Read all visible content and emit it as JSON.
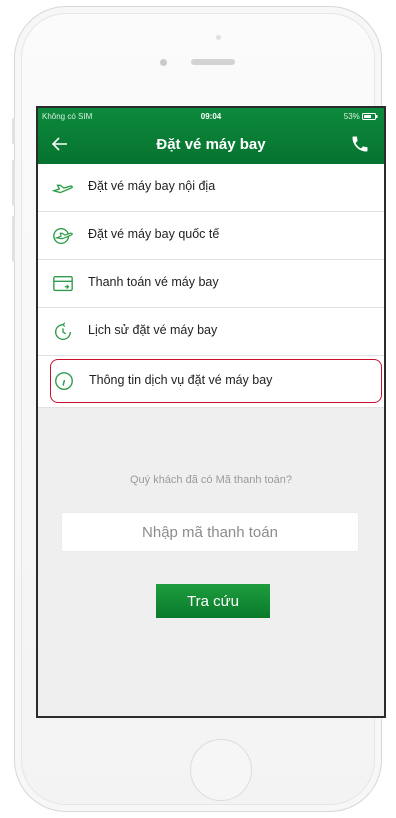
{
  "status_bar": {
    "carrier": "Không có SIM",
    "time": "09:04",
    "battery": "53%"
  },
  "header": {
    "title": "Đặt vé máy bay",
    "back_icon": "arrow-left-icon",
    "call_icon": "phone-icon"
  },
  "menu": {
    "items": [
      {
        "label": "Đặt vé máy bay nội địa",
        "icon": "plane-domestic-icon"
      },
      {
        "label": "Đặt vé máy bay quốc tế",
        "icon": "plane-international-icon"
      },
      {
        "label": "Thanh toán vé máy bay",
        "icon": "card-payment-icon"
      },
      {
        "label": "Lịch sử đặt vé máy bay",
        "icon": "history-clock-icon"
      },
      {
        "label": "Thông tin dịch vụ đặt vé máy bay",
        "icon": "info-icon"
      }
    ]
  },
  "payment_lookup": {
    "question": "Quý khách đã có Mã thanh toán?",
    "input_placeholder": "Nhập mã thanh toán",
    "button_label": "Tra cứu"
  },
  "colors": {
    "brand_green": "#0c8a3c",
    "highlight_red": "#c8102e"
  }
}
